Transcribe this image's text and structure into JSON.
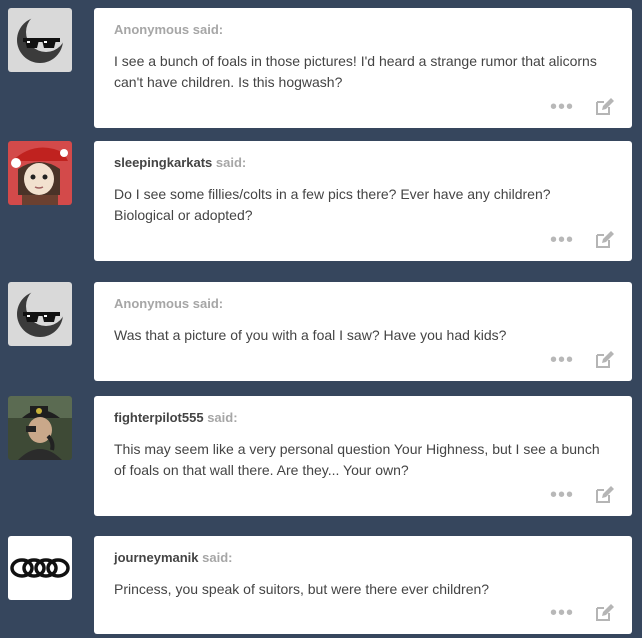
{
  "posts": [
    {
      "avatar": "sunglasses-moon-avatar",
      "asker": "Anonymous",
      "said": "said:",
      "question": "I see a bunch of foals in those pictures! I'd heard a strange rumor that alicorns can't have children. Is this hogwash?"
    },
    {
      "avatar": "sleepingkarkats-avatar",
      "asker": "sleepingkarkats",
      "said": "said:",
      "question": "Do I see some fillies/colts in a few pics there? Ever have any children? Biological or adopted?"
    },
    {
      "avatar": "sunglasses-moon-avatar",
      "asker": "Anonymous",
      "said": "said:",
      "question": "Was that a picture of you with a foal I saw? Have you had kids?"
    },
    {
      "avatar": "fighterpilot555-avatar",
      "asker": "fighterpilot555",
      "said": "said:",
      "question": "This may seem like a very personal question Your Highness, but I see a bunch of foals on that wall there. Are they... Your own?"
    },
    {
      "avatar": "journeymanik-rings-avatar",
      "asker": "journeymanik",
      "said": "said:",
      "question": "Princess, you speak of suitors, but were there ever children?"
    }
  ],
  "actions": {
    "more_icon": "ellipsis-icon",
    "edit_icon": "edit-icon"
  },
  "colors": {
    "background": "#36465d",
    "card": "#ffffff",
    "anon_name": "#a6a6a6",
    "text": "#444444"
  }
}
